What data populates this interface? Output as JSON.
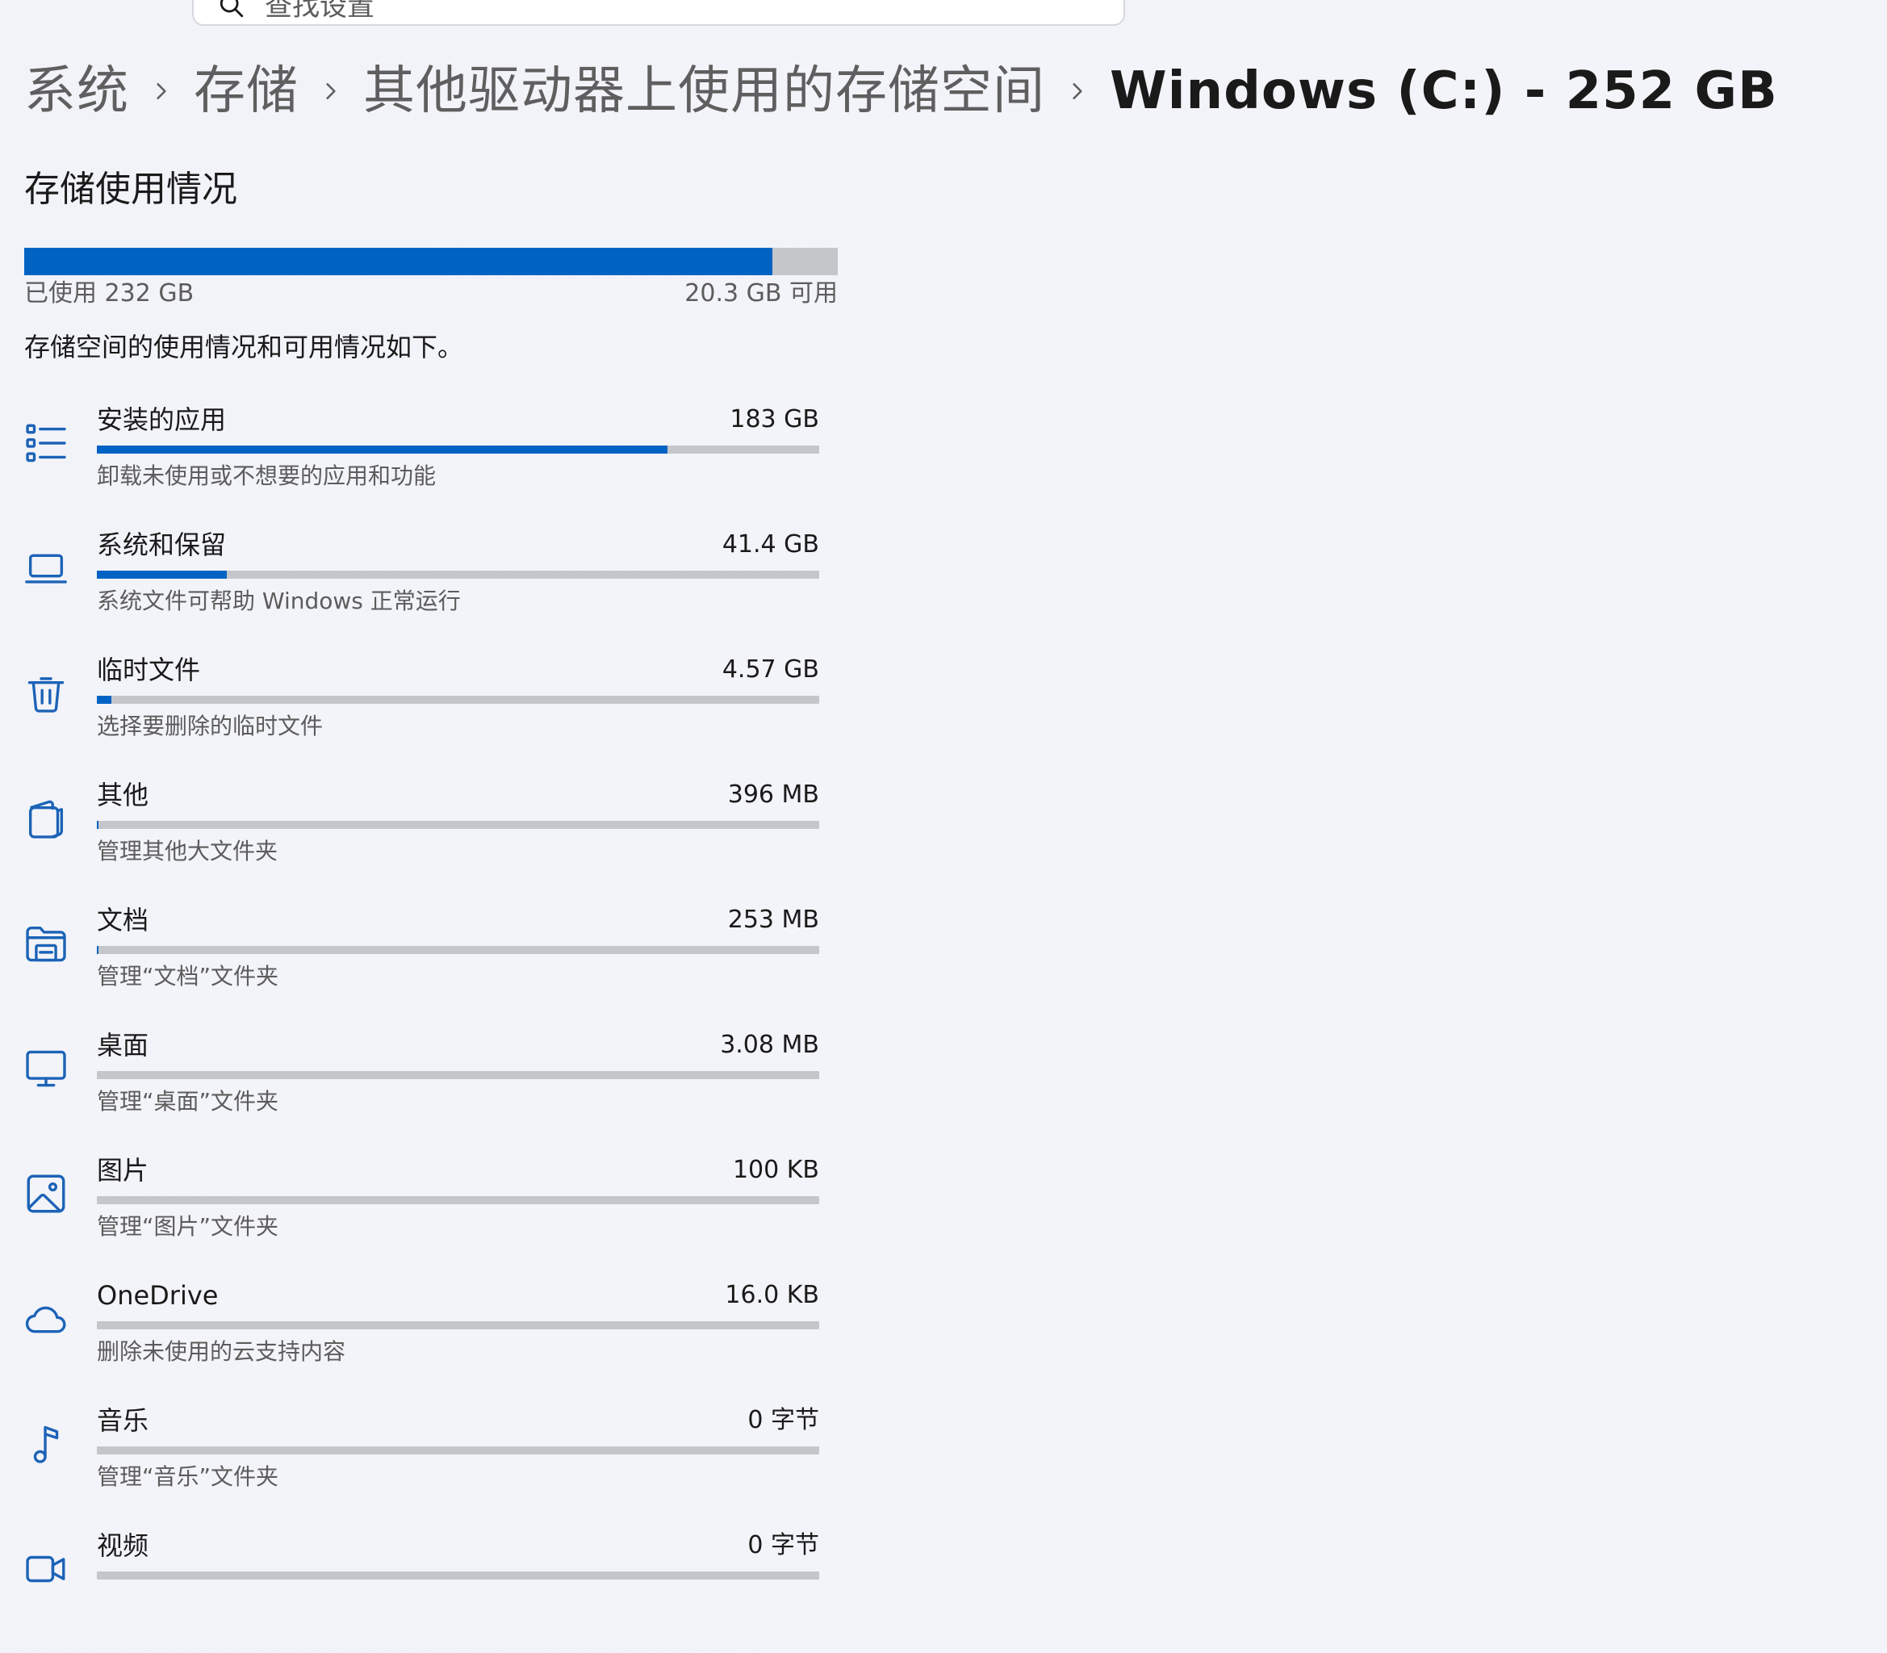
{
  "search": {
    "placeholder": "查找设置"
  },
  "breadcrumb": {
    "items": [
      "系统",
      "存储",
      "其他驱动器上使用的存储空间"
    ],
    "current": "Windows (C:) - 252 GB"
  },
  "storage": {
    "section_title": "存储使用情况",
    "used_label": "已使用 232 GB",
    "free_label": "20.3 GB 可用",
    "used_fraction": 0.92,
    "description": "存储空间的使用情况和可用情况如下。"
  },
  "categories": [
    {
      "name": "安装的应用",
      "size": "183 GB",
      "subtitle": "卸载未使用或不想要的应用和功能",
      "fraction": 0.79,
      "icon": "apps-list-icon"
    },
    {
      "name": "系统和保留",
      "size": "41.4 GB",
      "subtitle": "系统文件可帮助 Windows 正常运行",
      "fraction": 0.18,
      "icon": "laptop-icon"
    },
    {
      "name": "临时文件",
      "size": "4.57 GB",
      "subtitle": "选择要删除的临时文件",
      "fraction": 0.02,
      "icon": "trash-icon"
    },
    {
      "name": "其他",
      "size": "396 MB",
      "subtitle": "管理其他大文件夹",
      "fraction": 0.002,
      "icon": "document-stack-icon"
    },
    {
      "name": "文档",
      "size": "253 MB",
      "subtitle": "管理“文档”文件夹",
      "fraction": 0.001,
      "icon": "folder-documents-icon"
    },
    {
      "name": "桌面",
      "size": "3.08 MB",
      "subtitle": "管理“桌面”文件夹",
      "fraction": 0.0,
      "icon": "monitor-icon"
    },
    {
      "name": "图片",
      "size": "100 KB",
      "subtitle": "管理“图片”文件夹",
      "fraction": 0.0,
      "icon": "image-icon"
    },
    {
      "name": "OneDrive",
      "size": "16.0 KB",
      "subtitle": "删除未使用的云支持内容",
      "fraction": 0.0,
      "icon": "cloud-icon"
    },
    {
      "name": "音乐",
      "size": "0 字节",
      "subtitle": "管理“音乐”文件夹",
      "fraction": 0.0,
      "icon": "music-note-icon"
    },
    {
      "name": "视频",
      "size": "0 字节",
      "subtitle": "",
      "fraction": 0.0,
      "icon": "video-camera-icon"
    }
  ],
  "colors": {
    "accent": "#0063c4",
    "track": "#c5c6ca",
    "background": "#f2f4f9"
  }
}
